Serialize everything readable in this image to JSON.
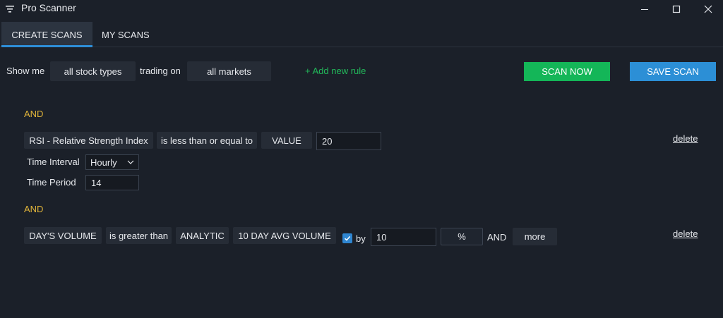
{
  "window": {
    "title": "Pro Scanner"
  },
  "tabs": [
    {
      "label": "CREATE SCANS",
      "active": true
    },
    {
      "label": "MY SCANS",
      "active": false
    }
  ],
  "filter": {
    "show_me_label": "Show me",
    "stock_types": "all stock types",
    "trading_on_label": "trading on",
    "markets": "all markets",
    "add_rule": "+ Add new rule"
  },
  "actions": {
    "scan_now": "SCAN NOW",
    "save_scan": "SAVE SCAN"
  },
  "rules": [
    {
      "conjunction": "AND",
      "indicator": "RSI - Relative Strength Index",
      "operator": "is less than or equal to",
      "compare_type": "VALUE",
      "value": "20",
      "time_interval_label": "Time Interval",
      "time_interval": "Hourly",
      "time_period_label": "Time Period",
      "time_period": "14",
      "delete_label": "delete"
    },
    {
      "conjunction": "AND",
      "indicator": "DAY'S VOLUME",
      "operator": "is greater than",
      "compare_type": "ANALYTIC",
      "analytic": "10 DAY AVG VOLUME",
      "by_checked": true,
      "by_label": "by",
      "by_value": "10",
      "unit": "%",
      "and_label": "AND",
      "more": "more",
      "delete_label": "delete"
    }
  ],
  "colors": {
    "background": "#1b2029",
    "accent_blue": "#2c8fd6",
    "accent_green": "#14b658",
    "and_gold": "#e0b43a"
  }
}
